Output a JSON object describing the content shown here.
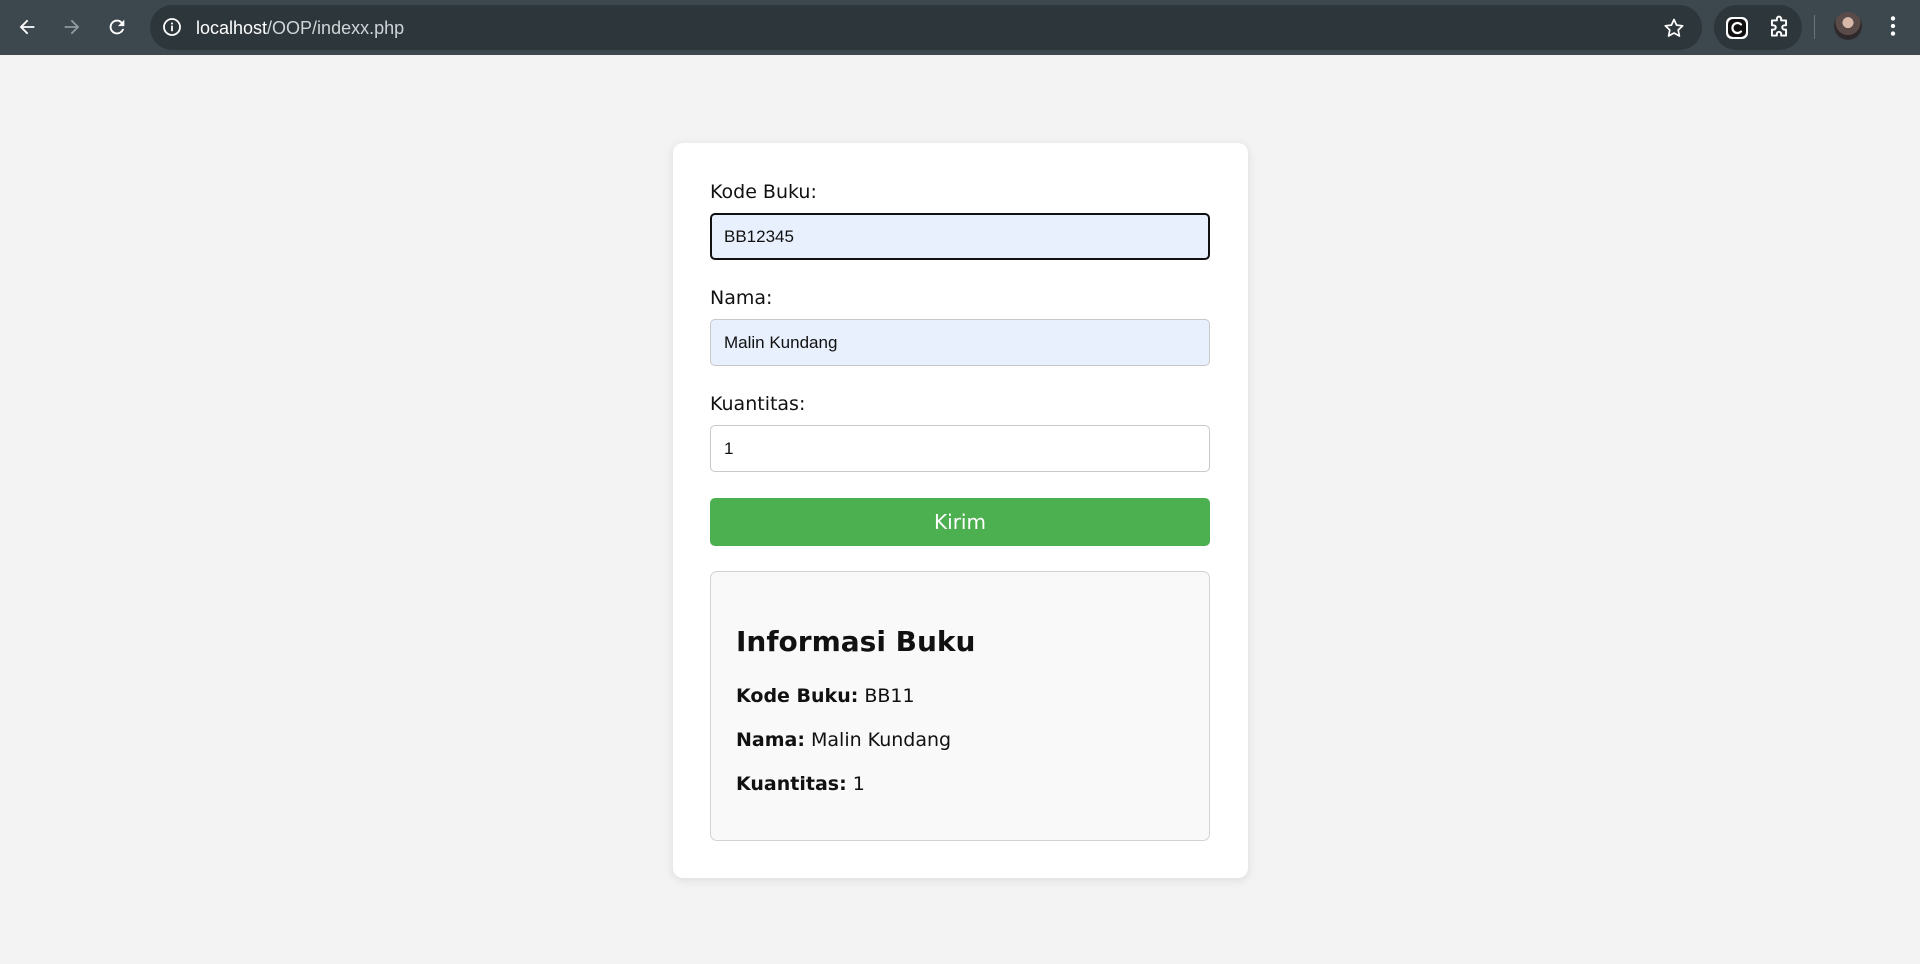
{
  "browser": {
    "url_host": "localhost",
    "url_path": "/OOP/indexx.php"
  },
  "form": {
    "kode_label": "Kode Buku:",
    "kode_value": "BB12345",
    "nama_label": "Nama:",
    "nama_value": "Malin Kundang",
    "kuantitas_label": "Kuantitas:",
    "kuantitas_value": "1",
    "submit_label": "Kirim"
  },
  "info": {
    "title": "Informasi Buku",
    "kode_label": "Kode Buku:",
    "kode_value": "BB11",
    "nama_label": "Nama:",
    "nama_value": "Malin Kundang",
    "kuantitas_label": "Kuantitas:",
    "kuantitas_value": "1"
  },
  "icons": {
    "back": "back-arrow-icon",
    "forward": "forward-arrow-icon",
    "reload": "reload-icon",
    "site_info": "info-icon",
    "bookmark": "star-icon",
    "extension_a": "copilot-extension-icon",
    "extensions": "puzzle-icon",
    "profile": "avatar",
    "menu": "kebab-menu-icon"
  },
  "colors": {
    "chrome_bg": "#3c474e",
    "page_bg": "#f3f3f3",
    "submit_bg": "#4caf50",
    "autofill_bg": "#e8f0fe"
  }
}
